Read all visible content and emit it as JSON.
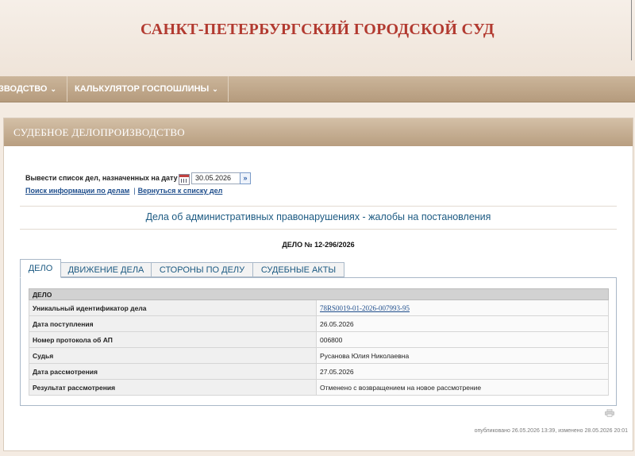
{
  "header": {
    "site_title": "САНКТ-ПЕТЕРБУРГСКИЙ ГОРОДСКОЙ СУД"
  },
  "nav": {
    "items": [
      {
        "label": "ЗВОДСТВО"
      },
      {
        "label": "КАЛЬКУЛЯТОР ГОСПОШЛИНЫ"
      }
    ],
    "chevron": "⌄"
  },
  "panel": {
    "title": "СУДЕБНОЕ ДЕЛОПРОИЗВОДСТВО",
    "date_label": "Вывести список дел, назначенных на дату",
    "date_value": "30.05.2026",
    "go_symbol": "»",
    "link_search": "Поиск информации по делам",
    "link_sep": "|",
    "link_back": "Вернуться к списку дел",
    "case_category": "Дела об административных правонарушениях - жалобы на постановления",
    "case_number": "ДЕЛО № 12-296/2026"
  },
  "tabs": [
    {
      "label": "ДЕЛО",
      "active": true
    },
    {
      "label": "ДВИЖЕНИЕ ДЕЛА",
      "active": false
    },
    {
      "label": "СТОРОНЫ ПО ДЕЛУ",
      "active": false
    },
    {
      "label": "СУДЕБНЫЕ АКТЫ",
      "active": false
    }
  ],
  "case_table": {
    "header": "ДЕЛО",
    "rows": [
      {
        "label": "Уникальный идентификатор дела",
        "value": "78RS0019-01-2026-007993-95"
      },
      {
        "label": "Дата поступления",
        "value": "26.05.2026"
      },
      {
        "label": "Номер протокола об АП",
        "value": "006800"
      },
      {
        "label": "Судья",
        "value": "Русанова Юлия Николаевна"
      },
      {
        "label": "Дата рассмотрения",
        "value": "27.05.2026"
      },
      {
        "label": "Результат рассмотрения",
        "value": "Отменено с возвращением на новое рассмотрение"
      }
    ]
  },
  "footer": {
    "published": "опубликовано 26.05.2026 13:39, изменено 28.05.2026 20:01"
  },
  "colors": {
    "title_red": "#b23a30",
    "nav_brown": "#b59b7d",
    "link_blue": "#1f4e8c",
    "category_blue": "#1c5a82"
  }
}
